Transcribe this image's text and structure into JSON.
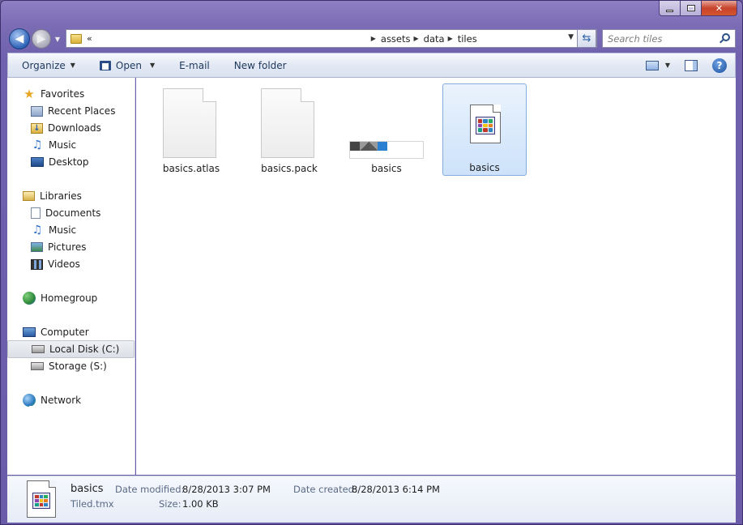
{
  "window": {
    "minimize": "minimize",
    "maximize": "maximize",
    "close": "✕"
  },
  "address": {
    "overflow": "«",
    "crumbs": [
      "assets",
      "data",
      "tiles"
    ]
  },
  "search": {
    "placeholder": "Search tiles"
  },
  "toolbar": {
    "organize": "Organize",
    "open": "Open",
    "email": "E-mail",
    "new_folder": "New folder",
    "help": "?"
  },
  "nav": {
    "favorites": "Favorites",
    "favorites_items": [
      "Recent Places",
      "Downloads",
      "Music",
      "Desktop"
    ],
    "libraries": "Libraries",
    "libraries_items": [
      "Documents",
      "Music",
      "Pictures",
      "Videos"
    ],
    "homegroup": "Homegroup",
    "computer": "Computer",
    "computer_items": [
      "Local Disk (C:)",
      "Storage (S:)"
    ],
    "network": "Network"
  },
  "files": [
    {
      "name": "basics.atlas",
      "kind": "generic"
    },
    {
      "name": "basics.pack",
      "kind": "generic"
    },
    {
      "name": "basics",
      "kind": "image"
    },
    {
      "name": "basics",
      "kind": "tmx",
      "selected": true
    }
  ],
  "details": {
    "name": "basics",
    "type": "Tiled.tmx",
    "modified_label": "Date modified:",
    "modified_value": "8/28/2013 3:07 PM",
    "size_label": "Size:",
    "size_value": "1.00 KB",
    "created_label": "Date created:",
    "created_value": "8/28/2013 6:14 PM"
  },
  "colors": {
    "tmx_tiles": [
      "#c0392b",
      "#2e86c1",
      "#27ae60",
      "#8e44ad",
      "#f1c40f",
      "#e67e22",
      "#16a085",
      "#c0392b",
      "#2e86c1"
    ]
  }
}
